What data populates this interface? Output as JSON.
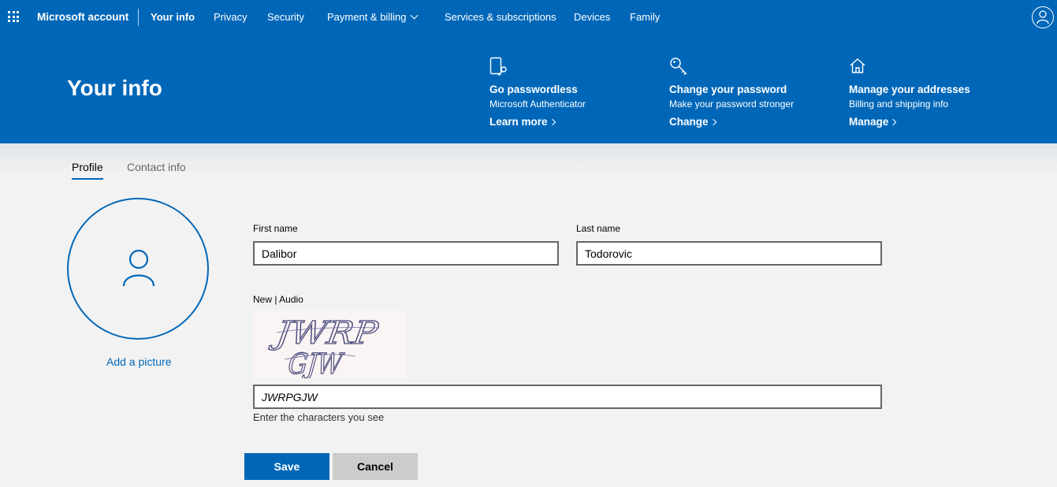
{
  "nav": {
    "brand": "Microsoft account",
    "items": [
      {
        "label": "Your info",
        "active": true
      },
      {
        "label": "Privacy"
      },
      {
        "label": "Security"
      },
      {
        "label": "Payment & billing",
        "dropdown": true
      },
      {
        "label": "Services & subscriptions"
      },
      {
        "label": "Devices"
      },
      {
        "label": "Family"
      }
    ],
    "icons": {
      "apps": "waffle-icon",
      "account": "person-icon"
    }
  },
  "hero": {
    "title": "Your info",
    "quick_links": [
      {
        "icon": "phone-key-icon",
        "title": "Go passwordless",
        "subtitle": "Microsoft Authenticator",
        "action": "Learn more"
      },
      {
        "icon": "key-icon",
        "title": "Change your password",
        "subtitle": "Make your password stronger",
        "action": "Change"
      },
      {
        "icon": "home-icon",
        "title": "Manage your addresses",
        "subtitle": "Billing and shipping info",
        "action": "Manage"
      }
    ]
  },
  "tabs": [
    {
      "label": "Profile",
      "active": true
    },
    {
      "label": "Contact info",
      "active": false
    }
  ],
  "profile": {
    "add_picture": "Add a picture"
  },
  "form": {
    "first_name_label": "First name",
    "first_name_value": "Dalibor",
    "last_name_label": "Last name",
    "last_name_value": "Todorovic",
    "captcha_new": "New",
    "captcha_separator": " | ",
    "captcha_audio": "Audio",
    "captcha_image_text": "JWRP GJW",
    "captcha_value": "JWRPGJW",
    "captcha_hint": "Enter the characters you see",
    "save": "Save",
    "cancel": "Cancel"
  },
  "colors": {
    "accent": "#0067b8",
    "page_bg": "#f2f2f2",
    "cancel_bg": "#cccccc"
  }
}
